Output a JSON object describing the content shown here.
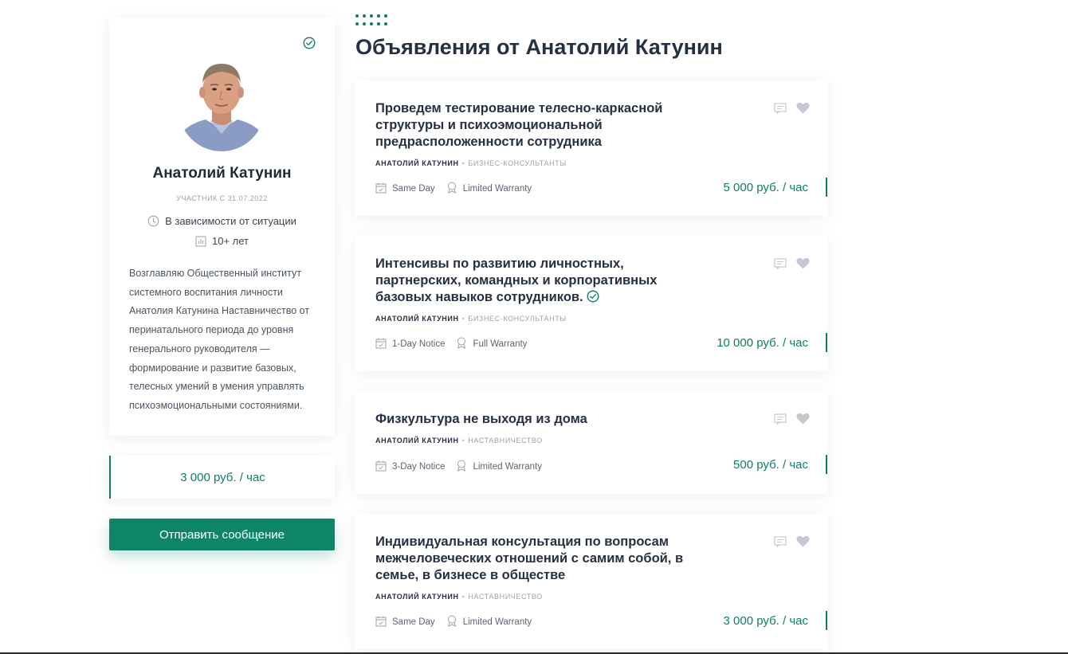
{
  "profile": {
    "name": "Анатолий Катунин",
    "member_since": "УЧАСТНИК С 31.07.2022",
    "availability": "В зависимости от ситуации",
    "experience": "10+ лет",
    "bio": "Возглавляю Общественный институт системного воспитания личности Анатолия Катунина Наставничество от перинатального периода до уровня генерального руководителя — формирование и развитие базовых, телесных умений в умения управлять психоэмоциональными состояниями.",
    "rate": "3 000 руб. / час",
    "send_button": "Отправить сообщение",
    "verified": true
  },
  "section": {
    "title": "Объявления от Анатолий Катунин"
  },
  "listings": [
    {
      "title": "Проведем тестирование телесно-каркасной структуры и психоэмоциональной предрасположенности сотрудника",
      "author": "АНАТОЛИЙ КАТУНИН",
      "category": "БИЗНЕС-КОНСУЛЬТАНТЫ",
      "delivery": "Same Day",
      "warranty": "Limited Warranty",
      "price": "5 000 руб. / час",
      "verified": false
    },
    {
      "title": "Интенсивы по развитию личностных, партнерских, командных и корпоративных базовых навыков сотрудников.",
      "author": "АНАТОЛИЙ КАТУНИН",
      "category": "БИЗНЕС-КОНСУЛЬТАНТЫ",
      "delivery": "1-Day Notice",
      "warranty": "Full Warranty",
      "price": "10 000 руб. / час",
      "verified": true
    },
    {
      "title": "Физкультура не выходя из дома",
      "author": "АНАТОЛИЙ КАТУНИН",
      "category": "НАСТАВНИЧЕСТВО",
      "delivery": "3-Day Notice",
      "warranty": "Limited Warranty",
      "price": "500 руб. / час",
      "verified": false
    },
    {
      "title": "Индивидуальная консультация по вопросам межчеловеческих отношений с самим собой, в семье, в бизнесе в обществе",
      "author": "АНАТОЛИЙ КАТУНИН",
      "category": "НАСТАВНИЧЕСТВО",
      "delivery": "Same Day",
      "warranty": "Limited Warranty",
      "price": "3 000 руб. / час",
      "verified": false
    }
  ],
  "colors": {
    "accent": "#107d66",
    "button": "#0e8569",
    "heading": "#253040",
    "muted": "#9aa3ad",
    "icon_gray": "#c3c9d0"
  },
  "icons": {
    "verified": "check-circle-icon",
    "availability": "clock-icon",
    "experience": "bar-chart-icon",
    "delivery": "calendar-icon",
    "warranty": "award-icon",
    "message": "message-icon",
    "favorite": "heart-icon",
    "decoration": "dots-grid-icon"
  }
}
